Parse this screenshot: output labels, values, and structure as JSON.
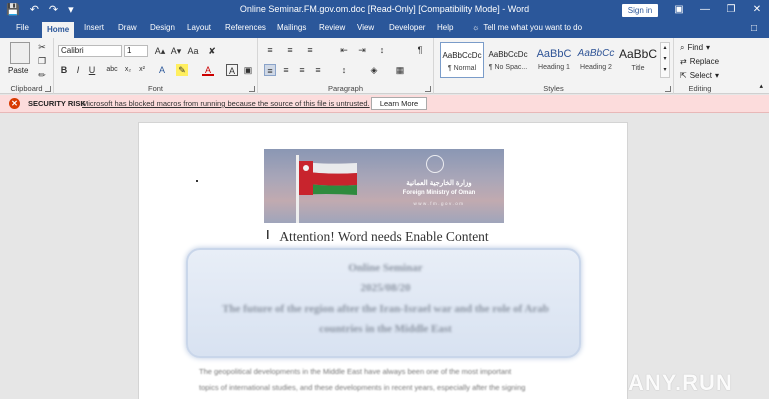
{
  "window": {
    "title": "Online Seminar.FM.gov.om.doc [Read-Only] [Compatibility Mode] - Word",
    "sign_in": "Sign in"
  },
  "tabs": [
    "File",
    "Home",
    "Insert",
    "Draw",
    "Design",
    "Layout",
    "References",
    "Mailings",
    "Review",
    "View",
    "Developer",
    "Help"
  ],
  "tell_me": "Tell me what you want to do",
  "ribbon": {
    "clipboard": {
      "label": "Clipboard",
      "paste": "Paste"
    },
    "font": {
      "label": "Font",
      "family": "Calibri",
      "size": "1"
    },
    "paragraph": {
      "label": "Paragraph"
    },
    "styles": {
      "label": "Styles",
      "items": [
        {
          "sample": "AaBbCcDc",
          "name": "¶ Normal"
        },
        {
          "sample": "AaBbCcDc",
          "name": "¶ No Spac..."
        },
        {
          "sample": "AaBbC",
          "name": "Heading 1"
        },
        {
          "sample": "AaBbCc",
          "name": "Heading 2"
        },
        {
          "sample": "AaBbC",
          "name": "Title"
        }
      ]
    },
    "editing": {
      "label": "Editing",
      "find": "Find",
      "replace": "Replace",
      "select": "Select"
    }
  },
  "security": {
    "title": "SECURITY RISK",
    "message": "Microsoft has blocked macros from running because the source of this file is untrusted.",
    "learn_more": "Learn More"
  },
  "document": {
    "banner": {
      "ministry_ar": "وزارة الخارجية العمانية",
      "ministry_en": "Foreign Ministry of Oman",
      "url": "www.fm.gov.om"
    },
    "attention": "Attention! Word needs Enable Content",
    "card": {
      "line1": "Online Seminar",
      "line2": "2025/08/20",
      "line3": "The future of the region after the Iran-Israel war and the role of Arab",
      "line4": "countries in the Middle East"
    },
    "body1": "The geopolitical developments in the Middle East have always been one of the most important",
    "body2": "topics of international studies, and these developments in recent years, especially after the signing"
  },
  "watermark": "ANY.RUN",
  "colors": {
    "title_bar": "#2b579a",
    "security_bar": "#fcdcdc",
    "security_icon": "#d83b01"
  }
}
